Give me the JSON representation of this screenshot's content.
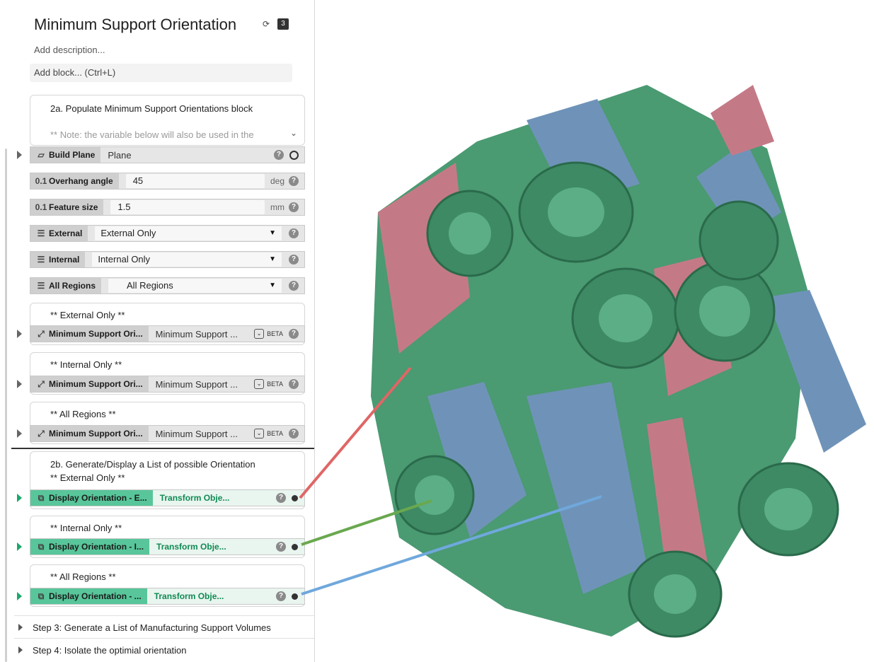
{
  "header": {
    "title": "Minimum Support Orientation",
    "description": "Add description...",
    "add_block": "Add block... (Ctrl+L)",
    "badge_count": "3"
  },
  "section_2a": {
    "title": "2a. Populate Minimum Support Orientations block",
    "note": "** Note: the variable below will also be used in the"
  },
  "inputs": {
    "build_plane": {
      "label": "Build Plane",
      "value": "Plane"
    },
    "overhang_angle": {
      "label": "Overhang angle",
      "value": "45",
      "unit": "deg"
    },
    "feature_size": {
      "label": "Feature size",
      "value": "1.5",
      "unit": "mm"
    },
    "external": {
      "label": "External",
      "value": "External Only"
    },
    "internal": {
      "label": "Internal",
      "value": "Internal Only"
    },
    "all_regions": {
      "label": "All Regions",
      "value": "All Regions"
    }
  },
  "min_support_blocks": [
    {
      "caption": "** External Only **",
      "label": "Minimum Support Ori...",
      "value": "Minimum Support ...",
      "badge": "BETA"
    },
    {
      "caption": "** Internal Only **",
      "label": "Minimum Support Ori...",
      "value": "Minimum Support ...",
      "badge": "BETA"
    },
    {
      "caption": "** All Regions **",
      "label": "Minimum Support Ori...",
      "value": "Minimum Support ...",
      "badge": "BETA"
    }
  ],
  "section_2b": {
    "title": "2b. Generate/Display a List of possible Orientation",
    "blocks": [
      {
        "caption": "** External Only **",
        "label": "Display Orientation - E...",
        "value": "Transform Obje...",
        "line_color": "#e06666"
      },
      {
        "caption": "** Internal Only **",
        "label": "Display Orientation  - I...",
        "value": "Transform Obje...",
        "line_color": "#6aa84f"
      },
      {
        "caption": "** All Regions **",
        "label": "Display Orientation  - ...",
        "value": "Transform Obje...",
        "line_color": "#6fa8dc"
      }
    ]
  },
  "steps": [
    {
      "label": "Step 3: Generate a List of Manufacturing Support Volumes"
    },
    {
      "label": "Step 4: Isolate the optimial orientation"
    }
  ],
  "model_colors": {
    "green": "#4a9a72",
    "pink": "#c47a86",
    "blue": "#6f93b8"
  }
}
